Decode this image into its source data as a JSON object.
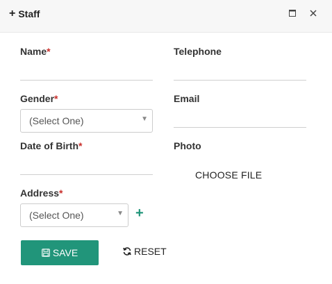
{
  "window": {
    "title": "Staff",
    "title_icon": "plus-icon",
    "maximize_glyph": "🗖",
    "close_glyph": "✕"
  },
  "form": {
    "name_label": "Name",
    "telephone_label": "Telephone",
    "gender_label": "Gender",
    "gender_value": "(Select One)",
    "email_label": "Email",
    "dob_label": "Date of Birth",
    "photo_label": "Photo",
    "choose_file": "CHOOSE FILE",
    "address_label": "Address",
    "address_value": "(Select One)",
    "add_glyph": "+",
    "required_mark": "*"
  },
  "actions": {
    "save_label": "SAVE",
    "reset_label": "RESET"
  },
  "colors": {
    "accent": "#21957a",
    "required": "#c9302c"
  }
}
